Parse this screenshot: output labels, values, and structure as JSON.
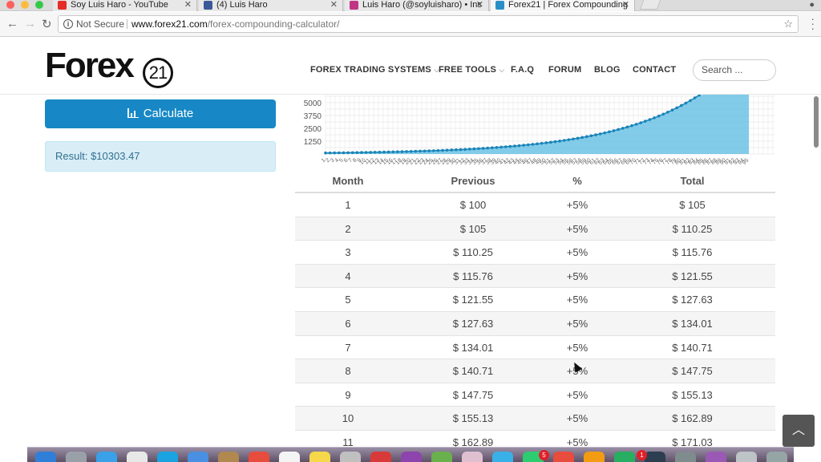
{
  "browser": {
    "tabs": [
      {
        "title": "Soy Luis Haro - YouTube",
        "favicon_color": "#e52d27"
      },
      {
        "title": "(4) Luis Haro",
        "favicon_color": "#3b5998"
      },
      {
        "title": "Luis Haro (@soyluisharo) • Ins",
        "favicon_color": "#c13584"
      },
      {
        "title": "Forex21 | Forex Compounding",
        "favicon_color": "#2b8fc7"
      }
    ],
    "close_glyph": "✕",
    "security_label": "Not Secure",
    "url_domain": "www.forex21.com",
    "url_path": "/forex-compounding-calculator/",
    "back_glyph": "←",
    "forward_glyph": "→",
    "reload_glyph": "↻",
    "star_glyph": "☆"
  },
  "site": {
    "logo_word": "Forex",
    "logo_number": "21",
    "nav": [
      {
        "label": "FOREX TRADING SYSTEMS",
        "caret": "⌵"
      },
      {
        "label": "FREE TOOLS",
        "caret": "⌵"
      },
      {
        "label": "F.A.Q",
        "caret": ""
      },
      {
        "label": "FORUM",
        "caret": ""
      },
      {
        "label": "BLOG",
        "caret": ""
      },
      {
        "label": "CONTACT",
        "caret": ""
      }
    ],
    "search_placeholder": "Search ...",
    "totop_glyph": "︿"
  },
  "calculator": {
    "button_label": "Calculate",
    "result": "Result: $10303.47"
  },
  "colors": {
    "accent": "#1788c5",
    "chart_fill": "#6cc3e6",
    "chart_line": "#1a84b8",
    "result_bg": "#d9edf7"
  },
  "chart_data": {
    "type": "area",
    "yticks": [
      1250,
      2500,
      3750,
      5000
    ],
    "start": 100,
    "rate_percent": 5,
    "months_shown": 95,
    "grid": true
  },
  "table": {
    "headers": [
      "Month",
      "Previous",
      "%",
      "Total"
    ],
    "rows": [
      [
        "1",
        "$ 100",
        "+5%",
        "$ 105"
      ],
      [
        "2",
        "$ 105",
        "+5%",
        "$ 110.25"
      ],
      [
        "3",
        "$ 110.25",
        "+5%",
        "$ 115.76"
      ],
      [
        "4",
        "$ 115.76",
        "+5%",
        "$ 121.55"
      ],
      [
        "5",
        "$ 121.55",
        "+5%",
        "$ 127.63"
      ],
      [
        "6",
        "$ 127.63",
        "+5%",
        "$ 134.01"
      ],
      [
        "7",
        "$ 134.01",
        "+5%",
        "$ 140.71"
      ],
      [
        "8",
        "$ 140.71",
        "+5%",
        "$ 147.75"
      ],
      [
        "9",
        "$ 147.75",
        "+5%",
        "$ 155.13"
      ],
      [
        "10",
        "$ 155.13",
        "+5%",
        "$ 162.89"
      ],
      [
        "11",
        "$ 162.89",
        "+5%",
        "$ 171.03"
      ]
    ]
  },
  "dock": {
    "badges": [
      "5",
      "1"
    ]
  }
}
